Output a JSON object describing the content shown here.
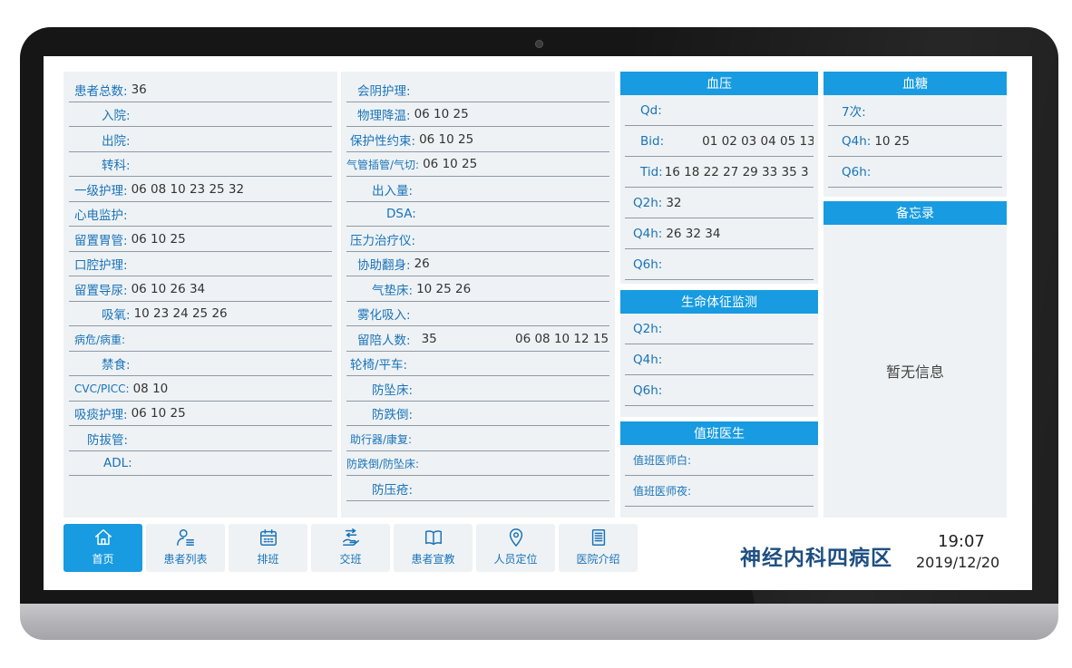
{
  "col1": [
    {
      "label": "患者总数:",
      "value": "36"
    },
    {
      "label": "入院:",
      "value": ""
    },
    {
      "label": "出院:",
      "value": ""
    },
    {
      "label": "转科:",
      "value": ""
    },
    {
      "label": "一级护理:",
      "value": "06 08 10 23 25 32"
    },
    {
      "label": "心电监护:",
      "value": ""
    },
    {
      "label": "留置胃管:",
      "value": "06 10 25"
    },
    {
      "label": "口腔护理:",
      "value": ""
    },
    {
      "label": "留置导尿:",
      "value": "06 10 26 34"
    },
    {
      "label": "吸氧:",
      "value": "10 23 24 25 26"
    },
    {
      "label": "病危/病重:",
      "value": ""
    },
    {
      "label": "禁食:",
      "value": ""
    },
    {
      "label": "CVC/PICC:",
      "value": "08 10"
    },
    {
      "label": "吸痰护理:",
      "value": "06 10 25"
    },
    {
      "label": "防拔管:",
      "value": ""
    },
    {
      "label": "ADL:",
      "value": ""
    }
  ],
  "col2": [
    {
      "label": "会阴护理:",
      "value": ""
    },
    {
      "label": "物理降温:",
      "value": "06 10 25"
    },
    {
      "label": "保护性约束:",
      "value": "06 10 25"
    },
    {
      "label": "气管插管/气切:",
      "value": "06 10 25"
    },
    {
      "label": "出入量:",
      "value": ""
    },
    {
      "label": "DSA:",
      "value": ""
    },
    {
      "label": "压力治疗仪:",
      "value": ""
    },
    {
      "label": "协助翻身:",
      "value": "26"
    },
    {
      "label": "气垫床:",
      "value": "10 25 26"
    },
    {
      "label": "雾化吸入:",
      "value": ""
    },
    {
      "label": "留陪人数:",
      "value": "35",
      "value2": "06 08 10 12 15"
    },
    {
      "label": "轮椅/平车:",
      "value": ""
    },
    {
      "label": "防坠床:",
      "value": ""
    },
    {
      "label": "防跌倒:",
      "value": ""
    },
    {
      "label": "助行器/康复:",
      "value": ""
    },
    {
      "label": "防跌倒/防坠床:",
      "value": ""
    },
    {
      "label": "防压疮:",
      "value": ""
    }
  ],
  "blood_pressure": {
    "title": "血压",
    "rows": [
      {
        "label": "Qd:",
        "value": ""
      },
      {
        "label": "Bid:",
        "value": "01 02 03 04 05 13"
      },
      {
        "label": "Tid:",
        "value": "16 18 22 27 29 33 35 3"
      },
      {
        "label": "Q2h:",
        "value": "32"
      },
      {
        "label": "Q4h:",
        "value": "26 32 34"
      },
      {
        "label": "Q6h:",
        "value": ""
      }
    ]
  },
  "blood_sugar": {
    "title": "血糖",
    "rows": [
      {
        "label": "7次:",
        "value": ""
      },
      {
        "label": "Q4h:",
        "value": "10 25"
      },
      {
        "label": "Q6h:",
        "value": ""
      }
    ]
  },
  "vitals": {
    "title": "生命体征监测",
    "rows": [
      {
        "label": "Q2h:",
        "value": ""
      },
      {
        "label": "Q4h:",
        "value": ""
      },
      {
        "label": "Q6h:",
        "value": ""
      }
    ]
  },
  "doctor_on_duty": {
    "title": "值班医生",
    "rows": [
      {
        "label": "值班医师白:",
        "value": ""
      },
      {
        "label": "值班医师夜:",
        "value": ""
      }
    ]
  },
  "memo": {
    "title": "备忘录",
    "empty_text": "暂无信息"
  },
  "nav": [
    {
      "label": "首页",
      "icon": "home-icon"
    },
    {
      "label": "患者列表",
      "icon": "patient-list-icon"
    },
    {
      "label": "排班",
      "icon": "calendar-icon"
    },
    {
      "label": "交班",
      "icon": "handover-icon"
    },
    {
      "label": "患者宣教",
      "icon": "book-icon"
    },
    {
      "label": "人员定位",
      "icon": "location-pin-icon"
    },
    {
      "label": "医院介绍",
      "icon": "document-icon"
    }
  ],
  "ward_name": "神经内科四病区",
  "time": "19:07",
  "date": "2019/12/20",
  "colors": {
    "accent": "#189be0",
    "label": "#1a73b8",
    "panel": "#eef2f5",
    "ward": "#1f4f82"
  }
}
